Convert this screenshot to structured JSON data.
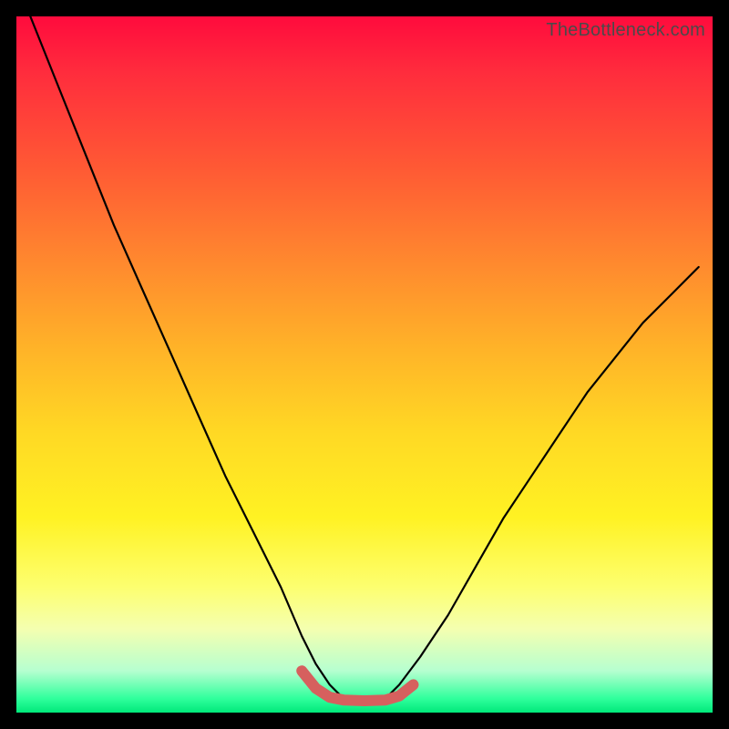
{
  "watermark": "TheBottleneck.com",
  "chart_data": {
    "type": "line",
    "title": "",
    "xlabel": "",
    "ylabel": "",
    "xlim": [
      0,
      100
    ],
    "ylim": [
      0,
      100
    ],
    "series": [
      {
        "name": "bottleneck-curve",
        "x": [
          2,
          6,
          10,
          14,
          18,
          22,
          26,
          30,
          34,
          38,
          41,
          43,
          45,
          47,
          50,
          53,
          55,
          58,
          62,
          66,
          70,
          74,
          78,
          82,
          86,
          90,
          94,
          98
        ],
        "values": [
          100,
          90,
          80,
          70,
          61,
          52,
          43,
          34,
          26,
          18,
          11,
          7,
          4,
          2,
          1.5,
          2,
          4,
          8,
          14,
          21,
          28,
          34,
          40,
          46,
          51,
          56,
          60,
          64
        ]
      },
      {
        "name": "valley-highlight",
        "x": [
          41,
          43,
          45,
          47,
          50,
          53,
          55,
          57
        ],
        "values": [
          6,
          3.5,
          2.2,
          1.8,
          1.7,
          1.8,
          2.4,
          4
        ]
      }
    ],
    "colors": {
      "curve": "#000000",
      "highlight": "#d6605e",
      "gradient_top": "#ff0b3d",
      "gradient_bottom": "#00e87a"
    }
  }
}
